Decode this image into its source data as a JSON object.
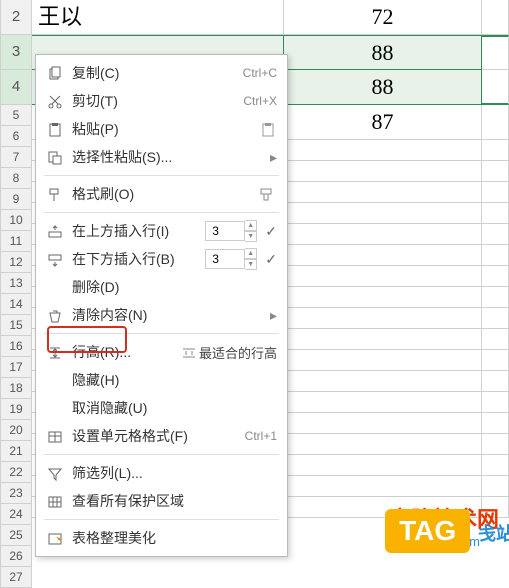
{
  "rows": {
    "2": {
      "c1": "王以",
      "c2": "72"
    },
    "3": {
      "c1": "",
      "c2": "88"
    },
    "4": {
      "c1": "",
      "c2": "88"
    },
    "5": {
      "c1": "",
      "c2": "87"
    }
  },
  "row_numbers": [
    "2",
    "3",
    "4",
    "5",
    "6",
    "7",
    "8",
    "9",
    "10",
    "11",
    "12",
    "13",
    "14",
    "15",
    "16",
    "17",
    "18",
    "19",
    "20",
    "21",
    "22",
    "23",
    "24",
    "25",
    "26",
    "27"
  ],
  "menu": {
    "copy": {
      "label": "复制(C)",
      "shortcut": "Ctrl+C"
    },
    "cut": {
      "label": "剪切(T)",
      "shortcut": "Ctrl+X"
    },
    "paste": {
      "label": "粘贴(P)"
    },
    "paste_special": {
      "label": "选择性粘贴(S)..."
    },
    "format_painter": {
      "label": "格式刷(O)"
    },
    "insert_above": {
      "label": "在上方插入行(I)",
      "value": "3"
    },
    "insert_below": {
      "label": "在下方插入行(B)",
      "value": "3"
    },
    "delete": {
      "label": "删除(D)"
    },
    "clear": {
      "label": "清除内容(N)"
    },
    "row_height": {
      "label": "行高(R)...",
      "sub": "最适合的行高"
    },
    "hide": {
      "label": "隐藏(H)"
    },
    "unhide": {
      "label": "取消隐藏(U)"
    },
    "format_cells": {
      "label": "设置单元格格式(F)",
      "shortcut": "Ctrl+1"
    },
    "filter": {
      "label": "筛选列(L)..."
    },
    "protection": {
      "label": "查看所有保护区域"
    },
    "beautify": {
      "label": "表格整理美化"
    }
  },
  "watermark": {
    "title": "电脑技术网",
    "url": "www.tagxp.com",
    "tag": "TAG",
    "tail": "戋站"
  }
}
